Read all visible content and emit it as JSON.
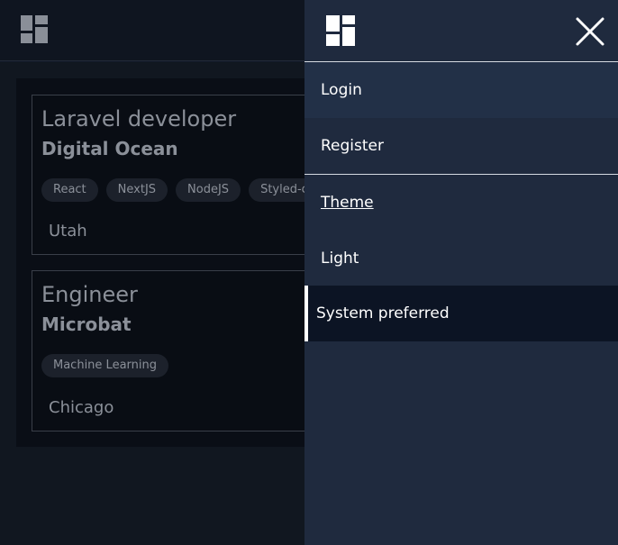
{
  "background": {
    "jobs": [
      {
        "title": "Laravel developer",
        "company": "Digital Ocean",
        "tags": [
          "React",
          "NextJS",
          "NodeJS",
          "Styled-co"
        ],
        "location": "Utah"
      },
      {
        "title": "Engineer",
        "company": "Microbat",
        "tags": [
          "Machine Learning"
        ],
        "location": "Chicago"
      }
    ]
  },
  "drawer": {
    "close_icon": "close-icon",
    "logo_icon": "dashboard-logo-icon",
    "items": {
      "login": "Login",
      "register": "Register",
      "theme": "Theme",
      "light": "Light",
      "system": "System preferred"
    }
  },
  "colors": {
    "drawer_bg": "#1f2a3e",
    "active_item_bg": "#0c1424",
    "page_bg": "#111827"
  }
}
